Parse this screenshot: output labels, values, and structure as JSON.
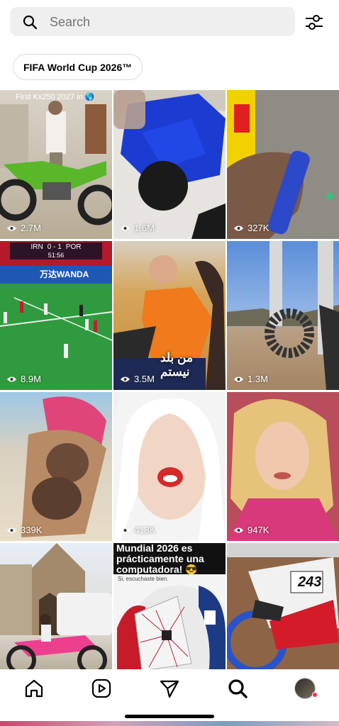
{
  "search": {
    "placeholder": "Search",
    "icon": "search-icon"
  },
  "filter": {
    "icon": "filter-sliders-icon"
  },
  "chip": {
    "label": "FIFA World Cup 2026™"
  },
  "tiles": [
    {
      "views": "2.7M",
      "overlay": "First Kx250 2027 in 🌎"
    },
    {
      "views": "1.6M"
    },
    {
      "views": "327K"
    },
    {
      "views": "8.9M",
      "scoreboard": {
        "home": "IRN",
        "score": "0 - 1",
        "away": "POR",
        "time": "51:56"
      },
      "ad": "万达WANDA"
    },
    {
      "views": "3.5M",
      "overlay": "من بلد نيستم"
    },
    {
      "views": "1.3M"
    },
    {
      "views": "339K"
    },
    {
      "views": "413K"
    },
    {
      "views": "947K"
    },
    {
      "views": ""
    },
    {
      "views": "",
      "overlay_title": "Mundial 2026 es prácticamente una computadora! 😎",
      "overlay_sub": "Si, escuchaste bien."
    },
    {
      "views": "",
      "bike_number": "243"
    }
  ],
  "nav": {
    "home": "home-icon",
    "reels": "reels-icon",
    "direct": "direct-send-icon",
    "search": "search-icon",
    "profile": "avatar"
  },
  "colors": {
    "accent": "#ff3040",
    "background": "#ffffff",
    "search_bg": "#efefef"
  }
}
